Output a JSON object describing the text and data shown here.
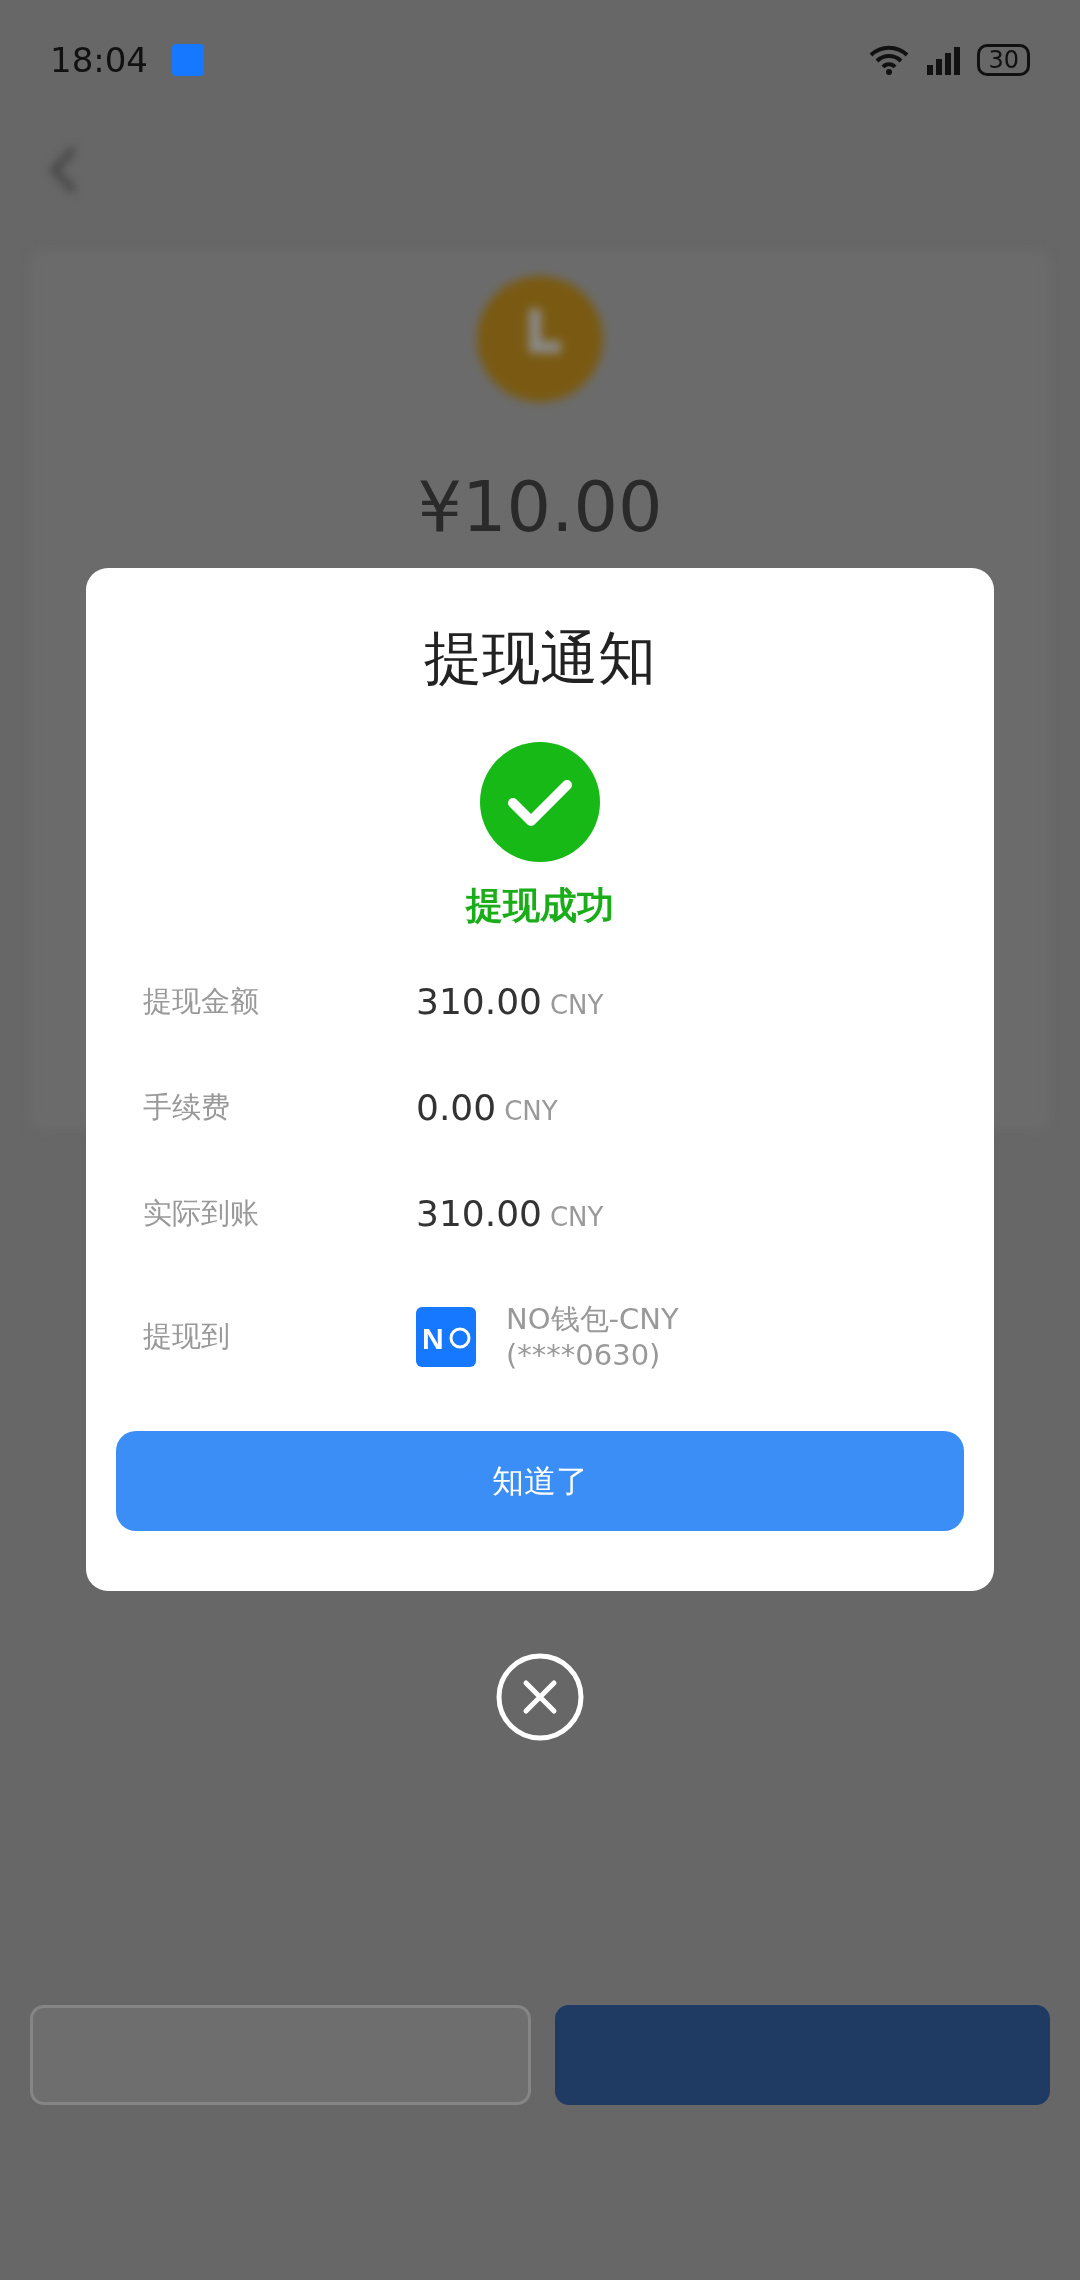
{
  "status_bar": {
    "time": "18:04",
    "battery": "30"
  },
  "background": {
    "amount": "¥10.00"
  },
  "dialog": {
    "title": "提现通知",
    "status": "提现成功",
    "rows": [
      {
        "kind": "amount",
        "label": "提现金额",
        "value": "310.00",
        "unit": "CNY"
      },
      {
        "kind": "amount",
        "label": "手续费",
        "value": "0.00",
        "unit": "CNY"
      },
      {
        "kind": "amount",
        "label": "实际到账",
        "value": "310.00",
        "unit": "CNY"
      },
      {
        "kind": "account",
        "label": "提现到",
        "logo": "N",
        "name": "NO钱包-CNY",
        "account": "(****0630)"
      }
    ],
    "button": "知道了"
  }
}
